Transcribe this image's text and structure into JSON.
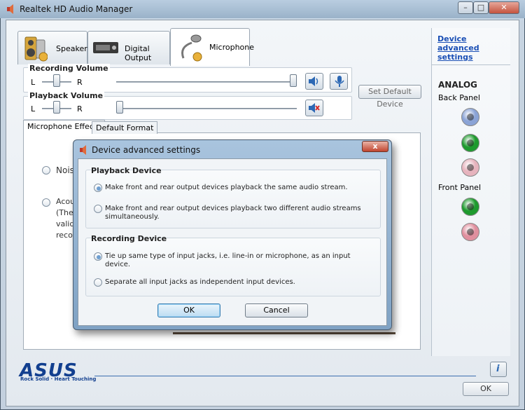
{
  "window": {
    "title": "Realtek HD Audio Manager"
  },
  "tabs": [
    {
      "label": "Speakers",
      "icon": "speakers-icon",
      "active": false
    },
    {
      "label": "Digital Output",
      "icon": "digital-output-icon",
      "active": false
    },
    {
      "label": "Microphone",
      "icon": "microphone-icon",
      "active": true
    }
  ],
  "recording_volume": {
    "title": "Recording Volume",
    "left_label": "L",
    "right_label": "R",
    "balance": 0.5,
    "level": 1.0
  },
  "playback_volume": {
    "title": "Playback Volume",
    "left_label": "L",
    "right_label": "R",
    "balance": 0.5,
    "level": 0.0
  },
  "set_default_button": "Set Default Device",
  "effects_tabs": [
    {
      "label": "Microphone Effects",
      "active": true
    },
    {
      "label": "Default Format",
      "active": false
    }
  ],
  "effects_options": [
    {
      "label": "Nois"
    },
    {
      "label": "Acou",
      "lines": [
        "(The",
        "valid",
        "reco"
      ]
    }
  ],
  "right_panel": {
    "link": "Device advanced settings",
    "section": "ANALOG",
    "back_panel": "Back Panel",
    "front_panel": "Front Panel",
    "back_jacks": [
      "#8aa3d6",
      "#1e9a2e",
      "#e6b3bd"
    ],
    "front_jacks": [
      "#1e9a2e",
      "#e08f9e"
    ]
  },
  "dialog": {
    "title": "Device advanced settings",
    "close_label": "x",
    "playback_section": "Playback Device",
    "playback_options": [
      {
        "text": "Make front and rear output devices playback the same audio stream.",
        "selected": true
      },
      {
        "text": "Make front and rear output devices playback two different audio streams simultaneously.",
        "selected": false
      }
    ],
    "recording_section": "Recording Device",
    "recording_options": [
      {
        "text": "Tie up same type of input jacks, i.e. line-in or microphone, as an input device.",
        "selected": true
      },
      {
        "text": "Separate all input jacks as independent input devices.",
        "selected": false
      }
    ],
    "ok_label": "OK",
    "cancel_label": "Cancel"
  },
  "branding": {
    "logo": "ASUS",
    "tagline": "Rock Solid · Heart Touching"
  },
  "info_button": "i",
  "ok_button": "OK"
}
